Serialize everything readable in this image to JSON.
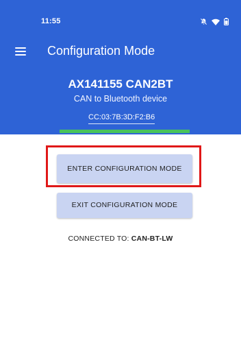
{
  "status_bar": {
    "time": "11:55",
    "icons": [
      "notifications-muted-icon",
      "wifi-icon",
      "battery-icon"
    ]
  },
  "app_bar": {
    "menu_icon": "menu-icon",
    "title": "Configuration Mode"
  },
  "device": {
    "name": "AX141155 CAN2BT",
    "description": "CAN to Bluetooth device",
    "mac": "CC:03:7B:3D:F2:B6"
  },
  "buttons": {
    "enter_label": "ENTER CONFIGURATION MODE",
    "exit_label": "EXIT CONFIGURATION MODE"
  },
  "connection": {
    "prefix": "CONNECTED TO: ",
    "name": "CAN-BT-LW"
  },
  "colors": {
    "header": "#2e63d6",
    "button": "#c9d4f2",
    "signal": "#49c35a",
    "highlight": "#e01818"
  }
}
